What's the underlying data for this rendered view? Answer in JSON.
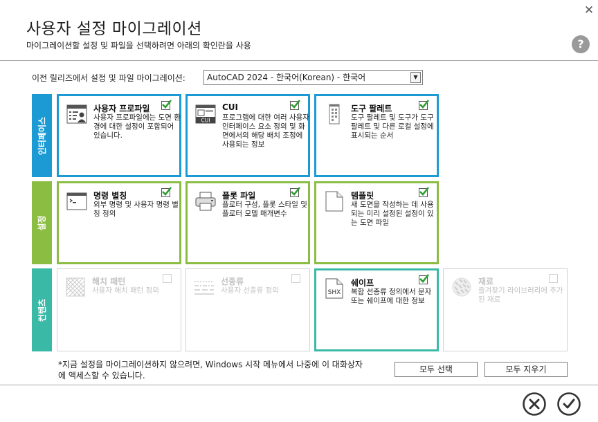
{
  "window": {
    "title": "사용자 설정 마이그레이션",
    "subtitle": "마이그레이션할 설정 및 파일을 선택하려면 아래의 확인란을 사용",
    "help_label": "?",
    "close_label": "✕"
  },
  "release": {
    "label": "이전 릴리즈에서 설정 및 파일 마이그레이션:",
    "selected": "AutoCAD 2024 - 한국어(Korean) - 한국어",
    "arrow": "▼"
  },
  "categories": {
    "interface": "인터페이스",
    "settings": "설정",
    "content": "컨텐츠"
  },
  "cards": {
    "user_profile": {
      "title": "사용자 프로파일",
      "desc": "사용자 프로파일에는 도면 환경에 대한 설정이 포함되어 있습니다.",
      "checked": true,
      "icon": "user-profile-icon"
    },
    "cui": {
      "title": "CUI",
      "desc": "프로그램에 대한 여러 사용자 인터페이스 요소 정의 및 화면에서의 해당 배치 조정에 사용되는 정보",
      "checked": true,
      "icon": "cui-icon",
      "icon_text": "CUI"
    },
    "tool_palette": {
      "title": "도구 팔레트",
      "desc": "도구 팔레트 및 도구가 도구 팔레트 및 다른 로컬 설정에 표시되는 순서",
      "checked": true,
      "icon": "tool-palette-icon"
    },
    "command_alias": {
      "title": "명령 별칭",
      "desc": "외부 명령 및 사용자 명령 별칭 정의",
      "checked": true,
      "icon": "command-alias-icon"
    },
    "plot_file": {
      "title": "플롯 파일",
      "desc": "플로터 구성, 플롯 스타일 및 플로터 모델 매개변수",
      "checked": true,
      "icon": "printer-icon"
    },
    "template": {
      "title": "템플릿",
      "desc": "새 도면을 작성하는 데 사용되는 미리 설정된 설정이 있는 도면 파일",
      "checked": true,
      "icon": "template-icon"
    },
    "hatch": {
      "title": "해치 패턴",
      "desc": "사용자 해치 패턴 정의",
      "checked": false,
      "icon": "hatch-pattern-icon"
    },
    "linetype": {
      "title": "선종류",
      "desc": "사용자 선종류 정의",
      "checked": false,
      "icon": "linetype-icon"
    },
    "shape": {
      "title": "쉐이프",
      "desc": "복합 선종류 정의에서 문자 또는 쉐이프에 대한 정보",
      "checked": true,
      "icon": "shape-icon",
      "icon_text": "SHX"
    },
    "material": {
      "title": "재료",
      "desc": "즐겨찾기 라이브러리에 추가된 재료",
      "checked": false,
      "icon": "material-icon"
    }
  },
  "footer": {
    "note": "*지금 설정을 마이그레이션하지 않으려면, Windows 시작 메뉴에서 나중에 이 대화상자에 액세스할 수 있습니다.",
    "select_all": "모두 선택",
    "clear_all": "모두 지우기"
  },
  "colors": {
    "interface": "#1b9ad4",
    "settings": "#8cbd43",
    "content": "#3bb9a7",
    "check": "#2e9e2e"
  }
}
